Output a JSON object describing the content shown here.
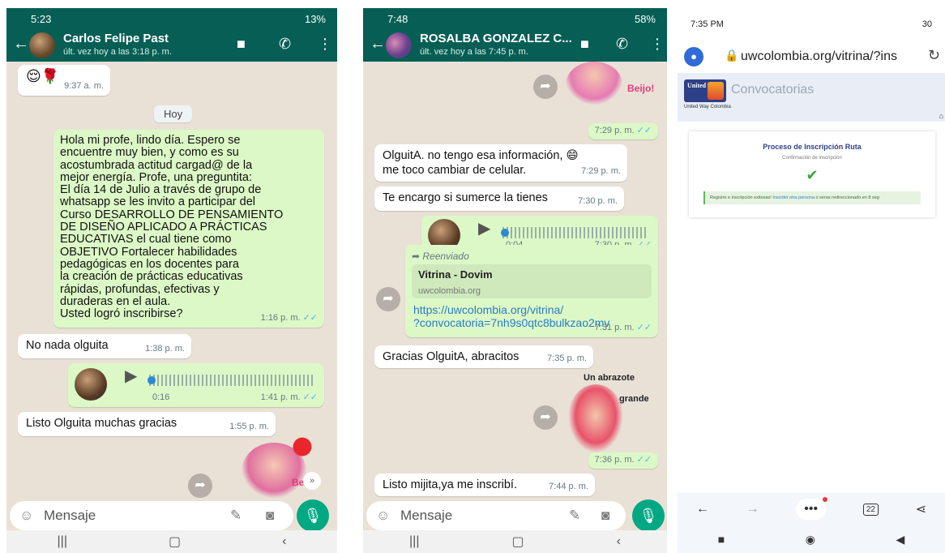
{
  "screen1": {
    "status_time": "5:23",
    "status_right": "13%",
    "contact_name": "Carlos Felipe Past",
    "last_seen": "últ. vez hoy a las 3:18 p. m.",
    "messages": [
      {
        "text": "😌🌹",
        "time": "9:37 a. m."
      },
      {
        "text": "Hoy"
      },
      {
        "lines": [
          "Hola mi profe, lindo día. Espero se",
          "encuentre muy bien, y como es su",
          "acostumbrada actitud cargad@ de la",
          "mejor energía. Profe, una preguntita:",
          "El día 14 de Julio a través de grupo de",
          "whatsapp se les invito a participar del",
          "Curso DESARROLLO DE PENSAMIENTO",
          "DE DISEÑO APLICADO A PRÁCTICAS",
          "EDUCATIVAS el cual tiene como",
          "OBJETIVO Fortalecer habilidades",
          "pedagógicas en los docentes para",
          "la creación de prácticas educativas",
          "rápidas, profundas, efectivas y",
          "duraderas en el aula.",
          "Usted logró inscribirse?"
        ],
        "time": "1:16 p. m."
      },
      {
        "text": "No nada olguita",
        "time": "1:38 p. m."
      },
      {
        "duration": "0:16",
        "time": "1:41 p. m."
      },
      {
        "text": "Listo Olguita muchas gracias",
        "time": "1:55 p. m."
      },
      {
        "text": "Be"
      }
    ],
    "input_placeholder": "Mensaje"
  },
  "screen2": {
    "status_time": "7:48",
    "status_right": "58%",
    "contact_name": "ROSALBA GONZALEZ C...",
    "last_seen": "últ. vez hoy a las 7:45 p. m.",
    "messages": [
      {
        "text": "Beijo!",
        "time": "7:29 p. m."
      },
      {
        "lines": [
          "OlguitA. no tengo esa información, 😄",
          "me toco cambiar de celular."
        ],
        "time": "7:29 p. m."
      },
      {
        "text": "Te encargo si sumerce la tienes",
        "time": "7:30 p. m."
      },
      {
        "duration": "0:04",
        "time": "7:30 p. m."
      },
      {
        "forwarded": "Reenviado",
        "card_title": "Vitrina - Dovim",
        "card_domain": "uwcolombia.org",
        "link_lines": [
          "https://uwcolombia.org/vitrina/",
          "?convocatoria=7nh9s0qtc8bulkzao2mv"
        ],
        "time": "7:31 p. m."
      },
      {
        "text": "Gracias OlguitA, abracitos",
        "time": "7:35 p. m."
      },
      {
        "sticker_top": "Un abrazote",
        "sticker_side": "grande",
        "time": "7:36 p. m."
      },
      {
        "text": "Listo mijita,ya me inscribí.",
        "time": "7:44 p. m."
      }
    ],
    "input_placeholder": "Mensaje"
  },
  "screen3": {
    "status_time": "7:35 PM",
    "status_right": "30",
    "url": "uwcolombia.org/vitrina/?ins",
    "banner_logo_text": "United Way",
    "banner_small": "United Way Colombia",
    "banner_title": "Convocatorias",
    "card_title": "Proceso de Inscripción Ruta",
    "card_subtitle": "Confirmación de inscripción",
    "success_text": "Registro e inscripción exitosas!",
    "success_link": "Inscribir otra persona",
    "success_tail": "o seras redireccionado en 8 seg",
    "tabs_count": "22"
  },
  "colors": {
    "whatsapp_header": "#075e54",
    "outgoing": "#dcf8c6",
    "incoming": "#ffffff",
    "chat_bg": "#e9e1d6",
    "mic": "#00a884",
    "read_ticks": "#4fb6ec",
    "link": "#2a7cc7"
  }
}
